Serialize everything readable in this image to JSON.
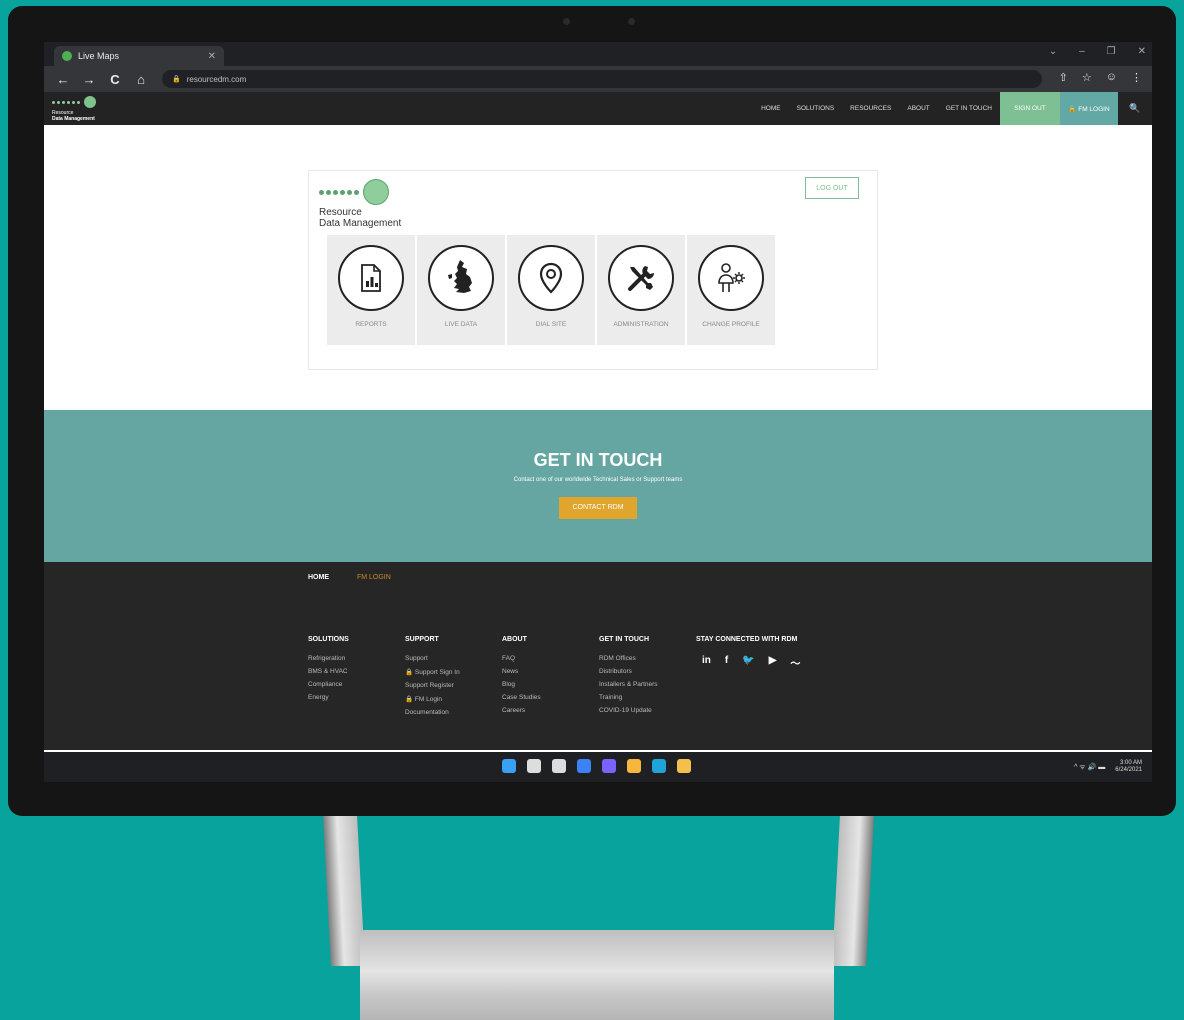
{
  "browser": {
    "tab_title": "Live Maps",
    "tab_close": "✕",
    "url": "resourcedm.com",
    "window_controls": [
      "⌄",
      "–",
      "❐",
      "✕"
    ],
    "nav_icons": [
      "back-icon",
      "forward-icon",
      "reload-icon",
      "home-icon"
    ],
    "nav_glyphs": [
      "←",
      "→",
      "C",
      "⌂"
    ],
    "right_glyphs": [
      "⇧",
      "☆",
      "☺",
      "⋮"
    ]
  },
  "site_header": {
    "logo_line1": "Resource",
    "logo_line2": "Data Management",
    "nav_items": [
      "HOME",
      "SOLUTIONS",
      "RESOURCES",
      "ABOUT",
      "GET IN TOUCH"
    ],
    "sign_out": "SIGN OUT",
    "fm_login": "🔒 FM LOGIN",
    "search_glyph": "🔍"
  },
  "card": {
    "logo_line1": "Resource",
    "logo_line2": "Data Management",
    "logout": "LOG OUT",
    "tiles": [
      {
        "label": "REPORTS",
        "icon": "report-icon"
      },
      {
        "label": "LIVE DATA",
        "icon": "uk-map-icon"
      },
      {
        "label": "DIAL SITE",
        "icon": "location-pin-icon"
      },
      {
        "label": "ADMINISTRATION",
        "icon": "tools-icon"
      },
      {
        "label": "CHANGE PROFILE",
        "icon": "profile-icon"
      }
    ]
  },
  "git": {
    "title": "GET IN TOUCH",
    "subtitle": "Contact one of our worldwide Technical Sales or Support teams",
    "button": "CONTACT RDM"
  },
  "footer": {
    "breadcrumb_home": "HOME",
    "breadcrumb_current": "FM LOGIN",
    "columns": [
      {
        "heading": "SOLUTIONS",
        "items": [
          "Refrigeration",
          "BMS & HVAC",
          "Compliance",
          "Energy"
        ]
      },
      {
        "heading": "SUPPORT",
        "items": [
          "Support",
          "🔒 Support Sign In",
          "Support Register",
          "🔒 FM Login",
          "Documentation"
        ]
      },
      {
        "heading": "ABOUT",
        "items": [
          "FAQ",
          "News",
          "Blog",
          "Case Studies",
          "Careers"
        ]
      },
      {
        "heading": "GET IN TOUCH",
        "items": [
          "RDM Offices",
          "Distributors",
          "Installers & Partners",
          "Training",
          "COVID-19 Update"
        ]
      }
    ],
    "social_heading": "STAY CONNECTED WITH RDM",
    "social": [
      "in",
      "f",
      "🐦",
      "▶",
      "〜"
    ]
  },
  "taskbar": {
    "icons": [
      "windows-start-icon",
      "search-icon",
      "task-view-icon",
      "widgets-icon",
      "teams-chat-icon",
      "file-explorer-icon",
      "edge-icon",
      "store-icon"
    ],
    "colors": [
      "#3aa0f3",
      "#dddddd",
      "#dddddd",
      "#3b82f6",
      "#7b61ff",
      "#f6b73c",
      "#1fa3d8",
      "#f3c14b"
    ],
    "tray": "^  ᯤ 🔊 ▬",
    "time": "3:00 AM",
    "date": "6/24/2021"
  }
}
